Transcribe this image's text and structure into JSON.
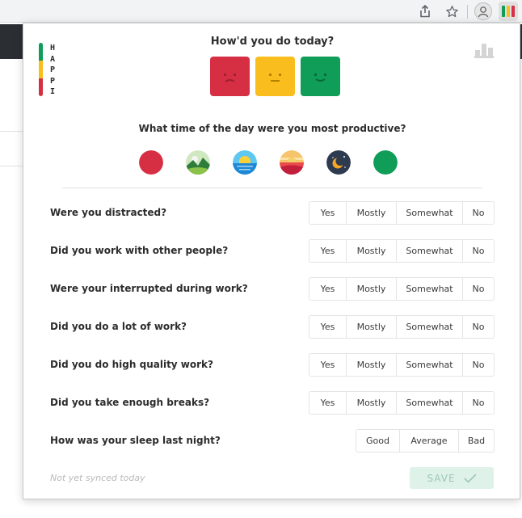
{
  "browser": {
    "icons": [
      "share-icon",
      "star-icon",
      "profile-avatar-icon",
      "happi-extension-icon"
    ]
  },
  "app": {
    "logo_letters": [
      "H",
      "A",
      "P",
      "P",
      "I"
    ],
    "title": "How'd you do today?",
    "moods": [
      {
        "name": "bad",
        "color": "#d62f44"
      },
      {
        "name": "neutral",
        "color": "#f9bd1d"
      },
      {
        "name": "good",
        "color": "#0f9d58"
      }
    ],
    "time_question": "What time of the day were you most productive?",
    "times": [
      "early-morning",
      "morning",
      "midday",
      "evening",
      "night",
      "all-day"
    ],
    "questions": [
      {
        "label": "Were you distracted?",
        "options": [
          "Yes",
          "Mostly",
          "Somewhat",
          "No"
        ]
      },
      {
        "label": "Did you work with other people?",
        "options": [
          "Yes",
          "Mostly",
          "Somewhat",
          "No"
        ]
      },
      {
        "label": "Were your interrupted during work?",
        "options": [
          "Yes",
          "Mostly",
          "Somewhat",
          "No"
        ]
      },
      {
        "label": "Did you do a lot of work?",
        "options": [
          "Yes",
          "Mostly",
          "Somewhat",
          "No"
        ]
      },
      {
        "label": "Did you do high quality work?",
        "options": [
          "Yes",
          "Mostly",
          "Somewhat",
          "No"
        ]
      },
      {
        "label": "Did you take enough breaks?",
        "options": [
          "Yes",
          "Mostly",
          "Somewhat",
          "No"
        ]
      },
      {
        "label": "How was your sleep last night?",
        "options": [
          "Good",
          "Average",
          "Bad"
        ]
      }
    ],
    "sync_status": "Not yet synced today",
    "save_label": "SAVE",
    "colors": {
      "red": "#d62f44",
      "yellow": "#f9bd1d",
      "green": "#0f9d58",
      "save_bg": "#dff2ea",
      "save_text": "#9cc7b2"
    }
  }
}
